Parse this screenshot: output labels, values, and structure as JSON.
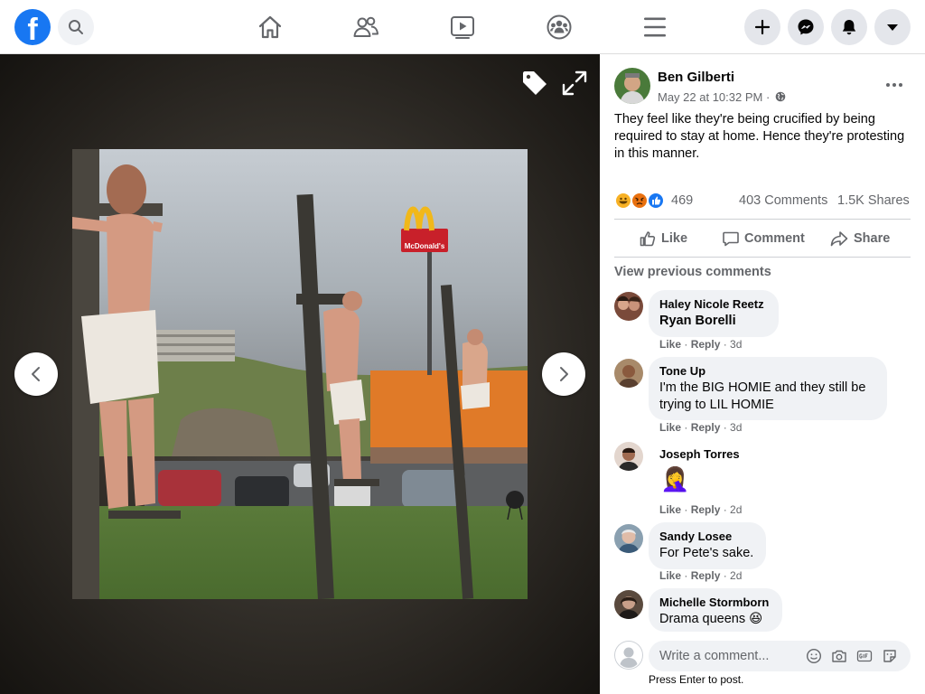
{
  "topbar": {
    "logo_letter": "f",
    "icons": [
      "facebook-logo",
      "search-icon",
      "home-icon",
      "friends-icon",
      "watch-icon",
      "groups-icon",
      "menu-icon",
      "plus-icon",
      "messenger-icon",
      "notifications-icon",
      "account-dropdown-icon"
    ]
  },
  "viewer": {
    "tools": [
      "tag-icon",
      "fullscreen-icon"
    ],
    "prev": "chevron-left-icon",
    "next": "chevron-right-icon",
    "photo_sign": "McDonald's"
  },
  "post": {
    "author": "Ben Gilberti",
    "time": "May 22 at 10:32 PM",
    "separator": "·",
    "privacy_icon": "globe-icon",
    "text": "They feel like they're being crucified by being required to stay at home. Hence they're protesting in this manner.",
    "reaction_count": "469",
    "comments_count": "403 Comments",
    "shares_count": "1.5K Shares",
    "actions": {
      "like": "Like",
      "comment": "Comment",
      "share": "Share"
    }
  },
  "comments_section": {
    "view_previous": "View previous comments",
    "comments": [
      {
        "name": "Haley Nicole Reetz",
        "text": "Ryan Borelli",
        "like": "Like",
        "reply": "Reply",
        "age": "3d"
      },
      {
        "name": "Tone Up",
        "text": "I'm the BIG HOMIE and they still be trying to LIL HOMIE",
        "like": "Like",
        "reply": "Reply",
        "age": "3d"
      },
      {
        "name": "Joseph Torres",
        "text": "🤦‍♀️",
        "like": "Like",
        "reply": "Reply",
        "age": "2d"
      },
      {
        "name": "Sandy Losee",
        "text": "For Pete's sake.",
        "like": "Like",
        "reply": "Reply",
        "age": "2d"
      },
      {
        "name": "Michelle Stormborn",
        "text": "Drama queens 😆",
        "like": "",
        "reply": "",
        "age": ""
      }
    ],
    "write_placeholder": "Write a comment...",
    "press_enter": "Press Enter to post."
  },
  "colors": {
    "brand": "#1877f2",
    "secondary_text": "#65676b",
    "bubble": "#f0f2f5"
  }
}
